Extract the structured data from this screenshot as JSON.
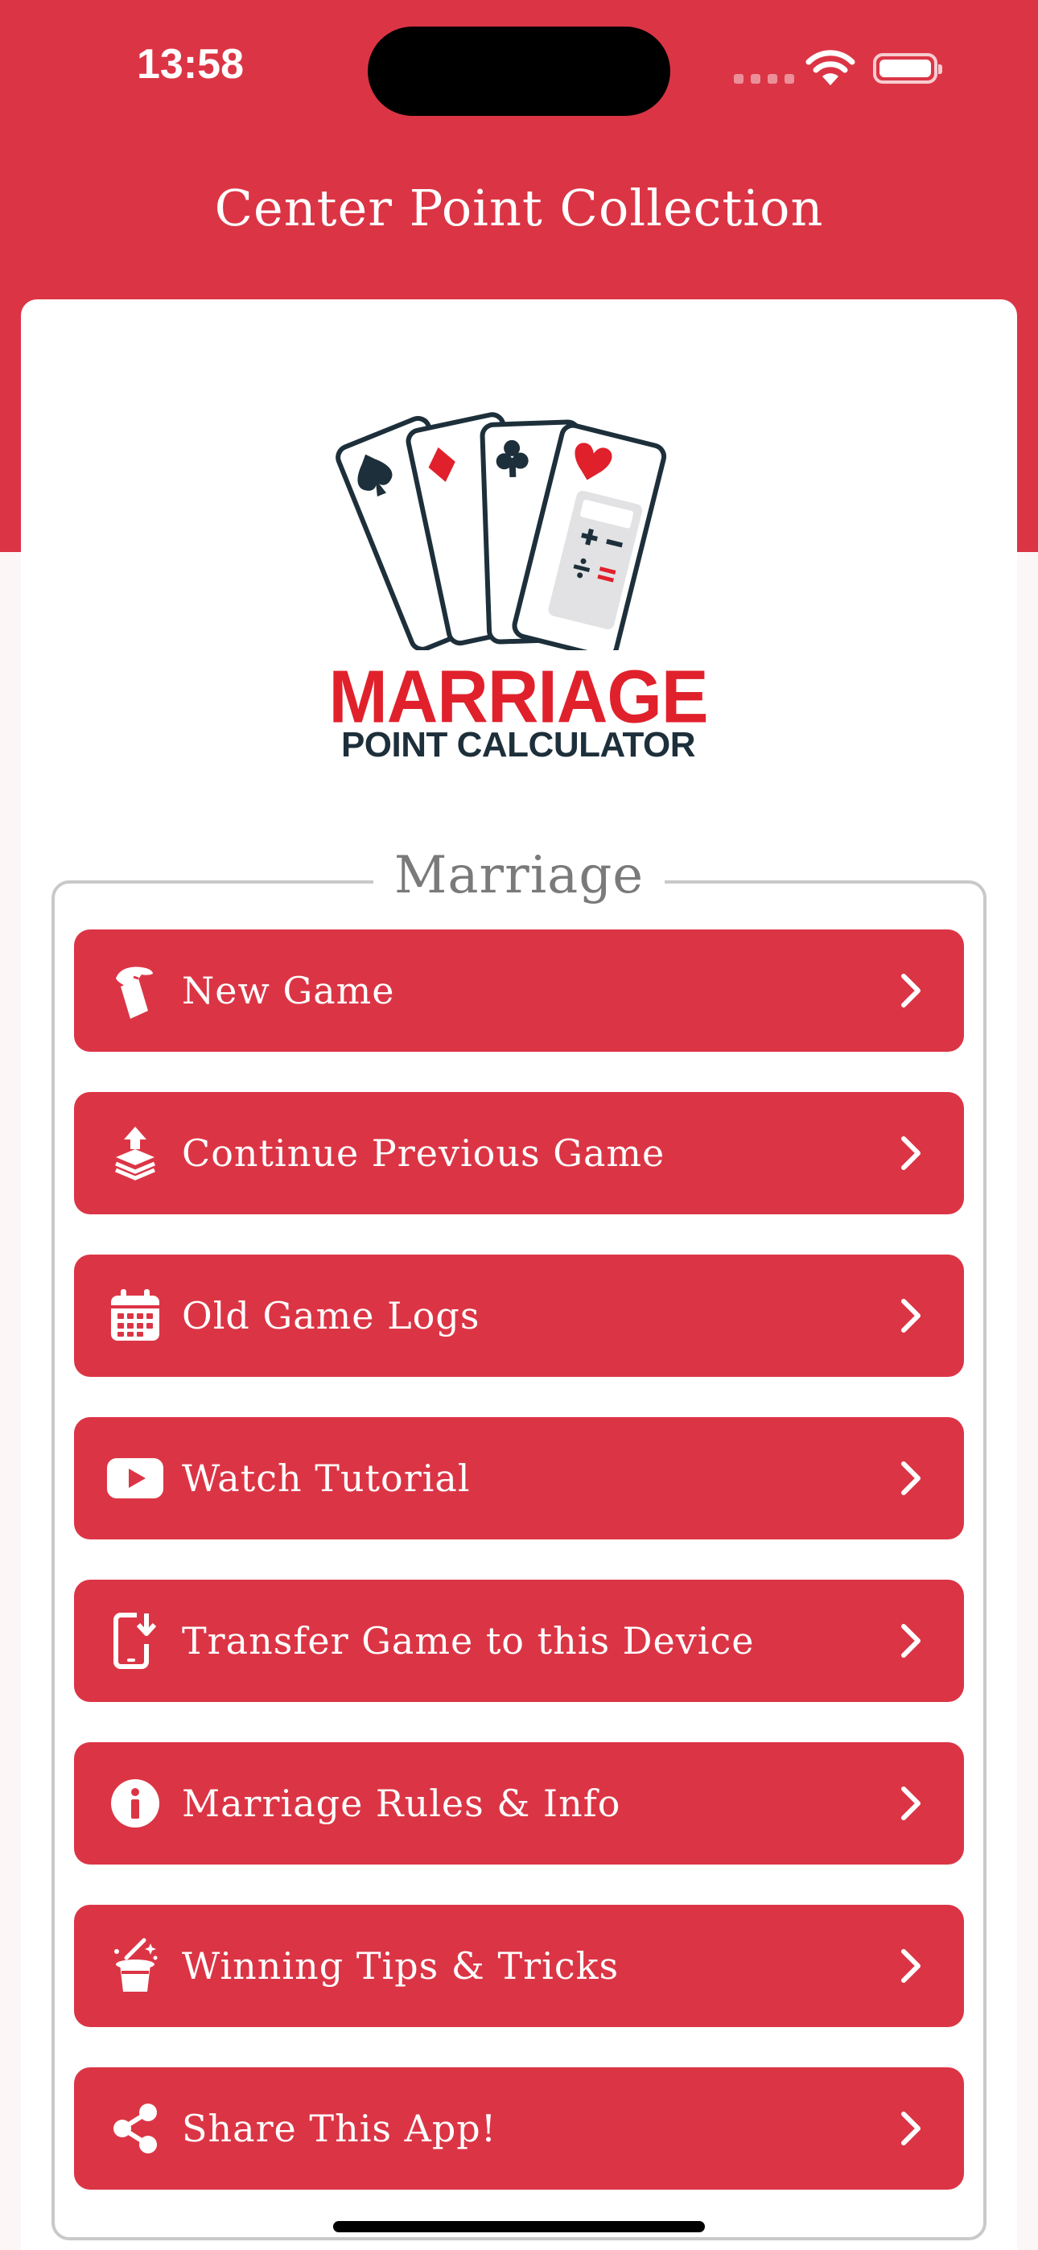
{
  "status": {
    "time": "13:58"
  },
  "header": {
    "title": "Center Point Collection"
  },
  "logo": {
    "word": "MARRIAGE",
    "subtitle": "POINT CALCULATOR"
  },
  "section": {
    "legend": "Marriage"
  },
  "menu": {
    "items": [
      {
        "label": "New Game",
        "icon": "hand-card-icon"
      },
      {
        "label": "Continue Previous Game",
        "icon": "stack-upload-icon"
      },
      {
        "label": "Old Game Logs",
        "icon": "calendar-icon"
      },
      {
        "label": "Watch Tutorial",
        "icon": "youtube-play-icon"
      },
      {
        "label": "Transfer Game to this Device",
        "icon": "phone-download-icon"
      },
      {
        "label": "Marriage Rules & Info",
        "icon": "info-icon"
      },
      {
        "label": "Winning Tips & Tricks",
        "icon": "magic-hat-icon"
      },
      {
        "label": "Share This App!",
        "icon": "share-icon"
      }
    ]
  },
  "colors": {
    "brand": "#db3545",
    "logo_red": "#e0212c",
    "logo_dark": "#1d2f3a"
  }
}
